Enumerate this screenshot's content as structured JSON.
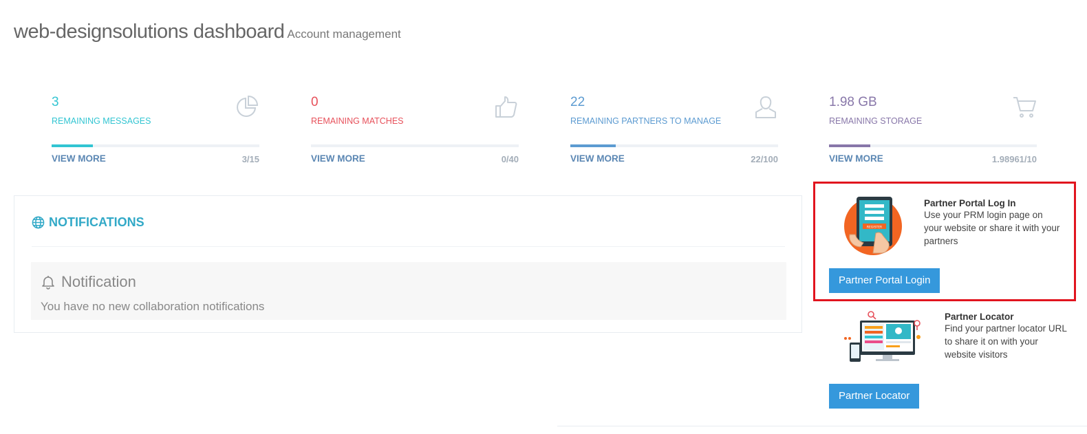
{
  "header": {
    "title": "web-designsolutions dashboard",
    "subtitle": "Account management"
  },
  "stats": [
    {
      "value": "3",
      "label": "REMAINING MESSAGES",
      "ratio": "3/15",
      "progress": 0.2,
      "color": "#32c5d2",
      "icon": "pie-chart-icon",
      "link": "VIEW MORE"
    },
    {
      "value": "0",
      "label": "REMAINING MATCHES",
      "ratio": "0/40",
      "progress": 0.0,
      "color": "#e7505a",
      "icon": "thumbs-up-icon",
      "link": "VIEW MORE"
    },
    {
      "value": "22",
      "label": "REMAINING PARTNERS TO MANAGE",
      "ratio": "22/100",
      "progress": 0.22,
      "color": "#5c9bd1",
      "icon": "user-icon",
      "link": "VIEW MORE"
    },
    {
      "value": "1.98 GB",
      "label": "REMAINING STORAGE",
      "ratio": "1.98961/10",
      "progress": 0.2,
      "color": "#8877a9",
      "icon": "cart-icon",
      "link": "VIEW MORE"
    }
  ],
  "notifications": {
    "heading": "NOTIFICATIONS",
    "panel_title": "Notification",
    "panel_text": "You have no new collaboration notifications"
  },
  "portal": {
    "title": "Partner Portal Log In",
    "description": "Use your PRM login page on your website or share it with your partners",
    "button": "Partner Portal Login",
    "illustration_label": "REGISTER"
  },
  "locator": {
    "title": "Partner Locator",
    "description": "Find your partner locator URL to share it on with your website visitors",
    "button": "Partner Locator"
  },
  "colors": {
    "accent": "#3598dc",
    "highlight_border": "#e1141e",
    "notification_heading": "#32a9c7"
  }
}
